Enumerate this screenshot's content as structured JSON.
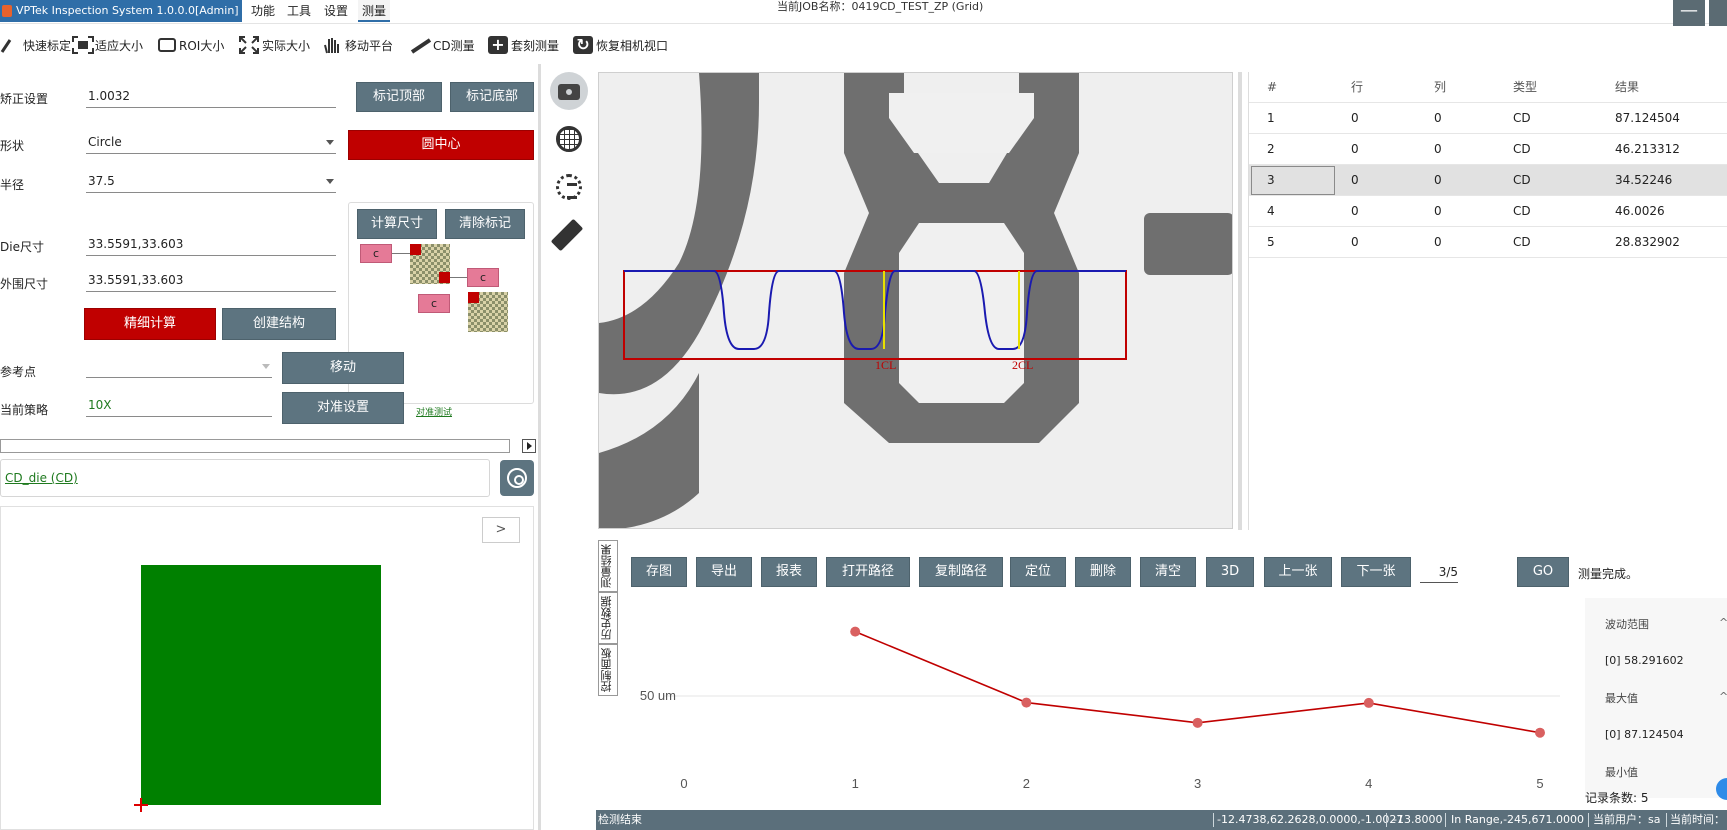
{
  "titlebar": {
    "app_title": "VPTek Inspection System 1.0.0.0[Admin]",
    "menus": [
      "功能",
      "工具",
      "设置",
      "测量"
    ],
    "active_menu": "测量",
    "job_name": "当前JOB名称：0419CD_TEST_ZP (Grid)",
    "minimize_label": "—"
  },
  "toolbar": {
    "items": [
      "快速标定",
      "适应大小",
      "ROI大小",
      "实际大小",
      "移动平台",
      "CD测量",
      "套刻测量",
      "恢复相机视口"
    ]
  },
  "left": {
    "correction_label": "矫正设置",
    "correction_value": "1.0032",
    "mark_top": "标记顶部",
    "mark_bottom": "标记底部",
    "shape_label": "形状",
    "shape_value": "Circle",
    "circle_center": "圆中心",
    "radius_label": "半径",
    "radius_value": "37.5",
    "die_size_label": "Die尺寸",
    "die_size_value": "33.5591,33.603",
    "outer_size_label": "外围尺寸",
    "outer_size_value": "33.5591,33.603",
    "calc_size": "计算尺寸",
    "clear_marks": "清除标记",
    "c_tags": [
      "c",
      "c",
      "c"
    ],
    "fine_calc": "精细计算",
    "create_structure": "创建结构",
    "ref_point_label": "参考点",
    "move": "移动",
    "strategy_label": "当前策略",
    "strategy_value": "10X",
    "align_settings": "对准设置",
    "align_test_link": "对准测试",
    "die_link": "CD_die (CD)",
    "next_label": ">"
  },
  "viewer": {
    "markers": [
      "1CL",
      "2CL"
    ]
  },
  "table": {
    "headers": [
      "#",
      "行",
      "列",
      "类型",
      "结果"
    ],
    "rows": [
      {
        "idx": "1",
        "row": "0",
        "col": "0",
        "type": "CD",
        "result": "87.124504"
      },
      {
        "idx": "2",
        "row": "0",
        "col": "0",
        "type": "CD",
        "result": "46.213312"
      },
      {
        "idx": "3",
        "row": "0",
        "col": "0",
        "type": "CD",
        "result": "34.52246"
      },
      {
        "idx": "4",
        "row": "0",
        "col": "0",
        "type": "CD",
        "result": "46.0026"
      },
      {
        "idx": "5",
        "row": "0",
        "col": "0",
        "type": "CD",
        "result": "28.832902"
      }
    ],
    "selected_row": 3
  },
  "bottom": {
    "vtabs": [
      "测量结果",
      "历史数据",
      "控制面板"
    ],
    "actions": [
      "存图",
      "导出",
      "报表",
      "打开路径",
      "复制路径",
      "定位",
      "删除",
      "清空",
      "3D",
      "上一张",
      "下一张"
    ],
    "page": "3/5",
    "go": "GO",
    "status_msg": "测量完成。"
  },
  "chart_data": {
    "type": "line",
    "x": [
      1,
      2,
      3,
      4,
      5
    ],
    "values": [
      87.124504,
      46.213312,
      34.52246,
      46.0026,
      28.832902
    ],
    "x_ticks": [
      "0",
      "1",
      "2",
      "3",
      "4",
      "5"
    ],
    "y_tick_label": "50 um",
    "xlim": [
      0,
      5
    ],
    "color": "#c00000"
  },
  "stats": {
    "range_label": "波动范围",
    "range_value": "[0]    58.291602",
    "max_label": "最大值",
    "max_value": "[0]    87.124504",
    "min_label": "最小值",
    "chev": "^",
    "record_count": "记录条数: 5"
  },
  "statusbar": {
    "left": "检测结束",
    "coords": "-12.4738,62.2628,0.0000,-1.0027",
    "z": "-13.8000",
    "range": "In Range,-245,671.0000",
    "user": "当前用户：sa",
    "time": "当前时间："
  }
}
